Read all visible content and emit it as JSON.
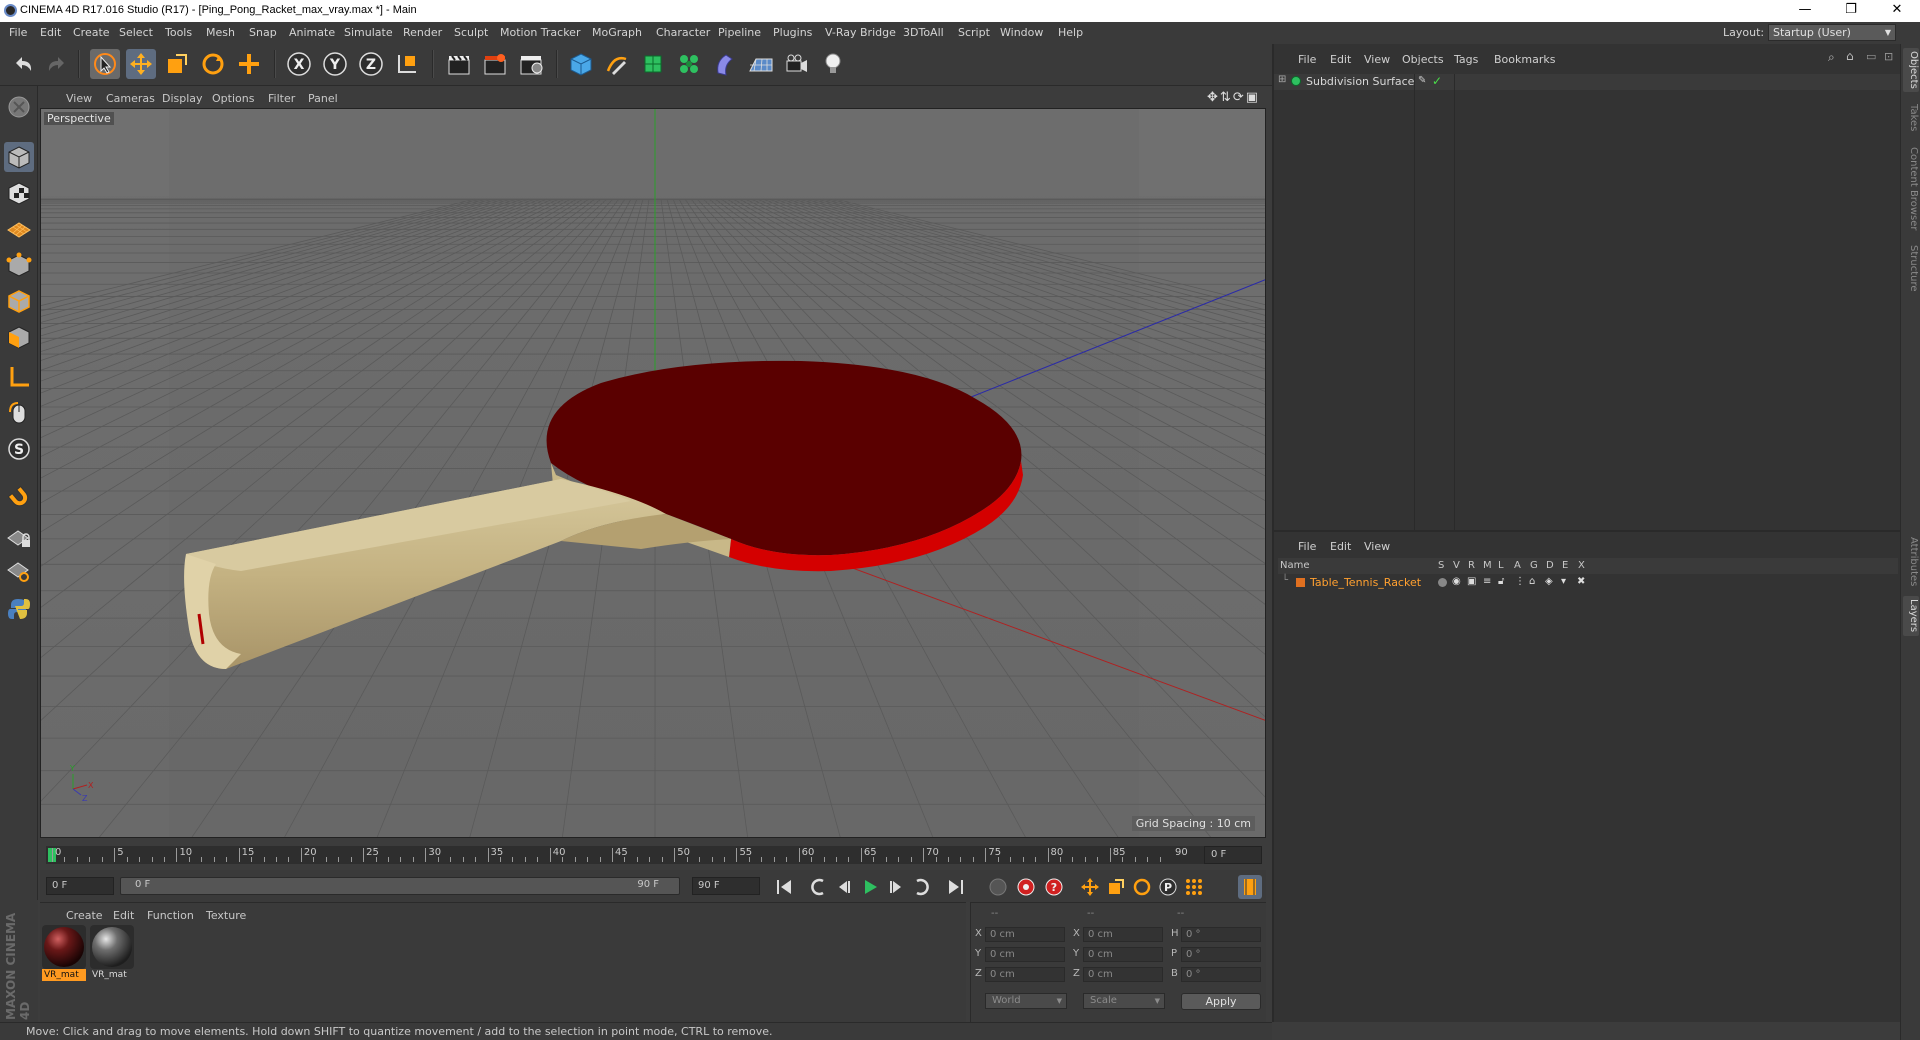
{
  "window": {
    "title": "CINEMA 4D R17.016 Studio (R17) - [Ping_Pong_Racket_max_vray.max *] - Main",
    "minimize": "—",
    "restore": "❐",
    "close": "✕"
  },
  "menubar": {
    "items": [
      "File",
      "Edit",
      "Create",
      "Select",
      "Tools",
      "Mesh",
      "Snap",
      "Animate",
      "Simulate",
      "Render",
      "Sculpt",
      "Motion Tracker",
      "MoGraph",
      "Character",
      "Pipeline",
      "Plugins",
      "V-Ray Bridge",
      "3DToAll",
      "Script",
      "Window",
      "Help"
    ],
    "layout_label": "Layout:",
    "layout_value": "Startup (User)"
  },
  "viewport": {
    "menus": [
      "View",
      "Cameras",
      "Display",
      "Options",
      "Filter",
      "Panel"
    ],
    "camera_label": "Perspective",
    "grid_spacing": "Grid Spacing : 10 cm",
    "colors": {
      "background": "#696969",
      "paddle": "#5a0000",
      "rubber_edge": "#d40000",
      "handle": "#c9b98c"
    }
  },
  "timeline": {
    "ticks": [
      "0",
      "5",
      "10",
      "15",
      "20",
      "25",
      "30",
      "35",
      "40",
      "45",
      "50",
      "55",
      "60",
      "65",
      "70",
      "75",
      "80",
      "85",
      "90"
    ],
    "end_field": "0 F"
  },
  "transport": {
    "start_field": "0 F",
    "range_start": "0 F",
    "range_end": "90 F",
    "end_field": "90 F"
  },
  "material_manager": {
    "menus": [
      "Create",
      "Edit",
      "Function",
      "Texture"
    ],
    "materials": [
      {
        "label": "VR_mat",
        "color": "#6a1818"
      },
      {
        "label": "VR_mat",
        "color": "#6e6e6e"
      }
    ],
    "brand": "MAXON CINEMA 4D"
  },
  "coordinates": {
    "header": [
      "--",
      "--",
      "--"
    ],
    "rows": [
      {
        "a1": "X",
        "v1": "0 cm",
        "a2": "X",
        "v2": "0 cm",
        "a3": "H",
        "v3": "0 °"
      },
      {
        "a1": "Y",
        "v1": "0 cm",
        "a2": "Y",
        "v2": "0 cm",
        "a3": "P",
        "v3": "0 °"
      },
      {
        "a1": "Z",
        "v1": "0 cm",
        "a2": "Z",
        "v2": "0 cm",
        "a3": "B",
        "v3": "0 °"
      }
    ],
    "mode1": "World",
    "mode2": "Scale",
    "apply": "Apply"
  },
  "object_manager": {
    "menus": [
      "File",
      "Edit",
      "View",
      "Objects",
      "Tags",
      "Bookmarks"
    ],
    "objects": [
      {
        "name": "Subdivision Surface"
      }
    ]
  },
  "layers_panel": {
    "menus": [
      "File",
      "Edit",
      "View"
    ],
    "columns": [
      "Name",
      "S",
      "V",
      "R",
      "M",
      "L",
      "A",
      "G",
      "D",
      "E",
      "X"
    ],
    "objects": [
      {
        "name": "Table_Tennis_Racket",
        "color": "#e07020"
      }
    ]
  },
  "right_tabs": [
    "Objects",
    "Takes",
    "Content Browser",
    "Structure",
    "Attributes",
    "Layers"
  ],
  "status": "Move: Click and drag to move elements. Hold down SHIFT to quantize movement / add to the selection in point mode, CTRL to remove."
}
